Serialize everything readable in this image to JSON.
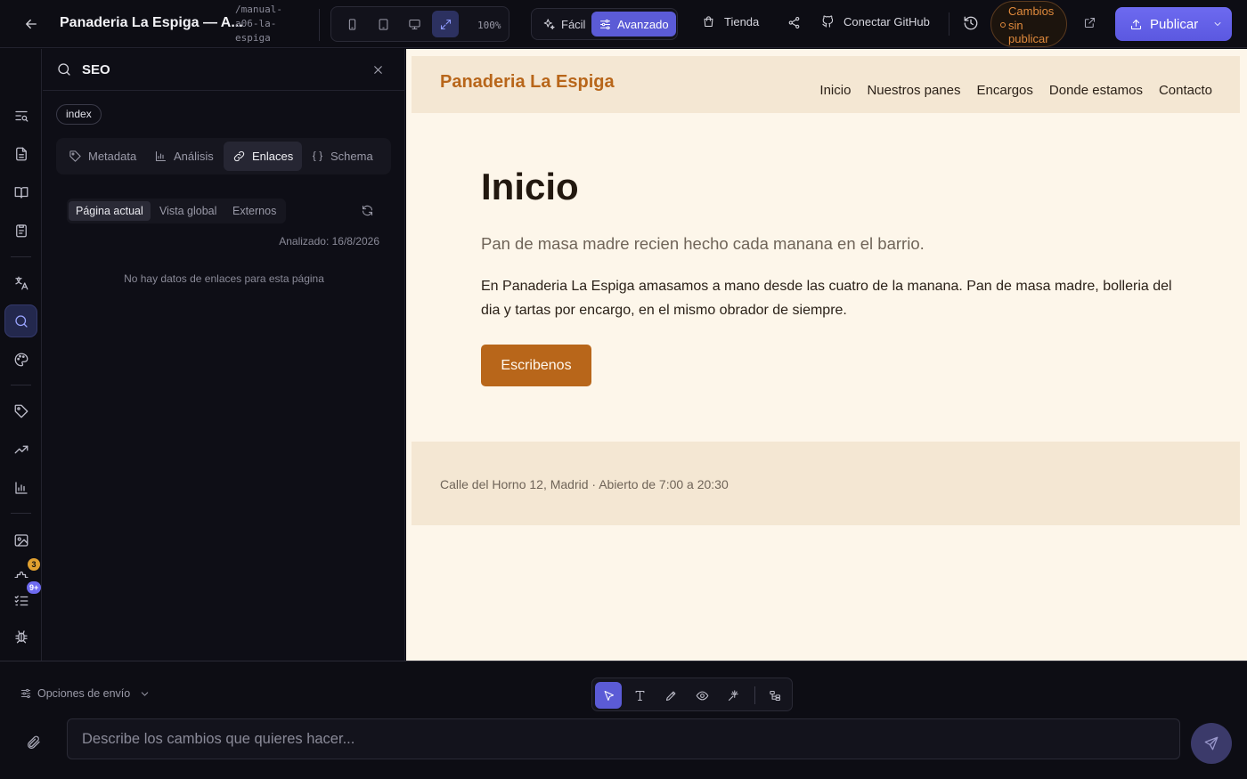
{
  "topbar": {
    "project_title": "Panaderia La Espiga — A...",
    "project_slug": "/manual-a06-la-espiga",
    "zoom": "100%",
    "mode_easy": "Fácil",
    "mode_advanced": "Avanzado",
    "store": "Tienda",
    "connect_github": "Conectar GitHub",
    "status": "Cambios sin publicar",
    "publish": "Publicar"
  },
  "rail": {
    "badge_extensions": "3",
    "badge_tasks": "9+"
  },
  "seo_panel": {
    "title": "SEO",
    "page_chip": "index",
    "tabs": [
      "Metadata",
      "Análisis",
      "Enlaces",
      "Schema"
    ],
    "active_tab": "Enlaces",
    "scope_tabs": [
      "Página actual",
      "Vista global",
      "Externos"
    ],
    "active_scope": "Página actual",
    "analyzed": "Analizado: 16/8/2026",
    "empty_message": "No hay datos de enlaces para esta página"
  },
  "preview": {
    "logo": "Panaderia La Espiga",
    "nav": [
      "Inicio",
      "Nuestros panes",
      "Encargos",
      "Donde estamos",
      "Contacto"
    ],
    "hero_title": "Inicio",
    "hero_subtitle": "Pan de masa madre recien hecho cada manana en el barrio.",
    "hero_body": "En Panaderia La Espiga amasamos a mano desde las cuatro de la manana. Pan de masa madre, bolleria del dia y tartas por encargo, en el mismo obrador de siempre.",
    "cta": "Escribenos",
    "footer": "Calle del Horno 12, Madrid · Abierto de 7:00 a 20:30"
  },
  "composer": {
    "send_options": "Opciones de envío",
    "placeholder": "Describe los cambios que quieres hacer..."
  },
  "colors": {
    "accent": "#5b5bd6",
    "warning": "#e08a3c",
    "brand_bakery": "#b8661a"
  }
}
